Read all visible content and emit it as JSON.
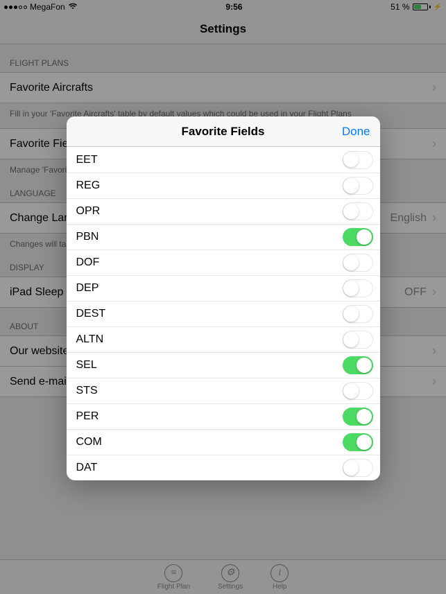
{
  "statusbar": {
    "carrier": "MegaFon",
    "time": "9:56",
    "battery_pct": "51 %"
  },
  "navbar": {
    "title": "Settings"
  },
  "sections": {
    "flight_plans": {
      "header": "FLIGHT PLANS",
      "favorite_aircrafts": "Favorite Aircrafts",
      "favorite_aircrafts_note": "Fill in your 'Favorite Aircrafts' table by default values which could be used in your Flight Plans",
      "favorite_fields": "Favorite Field",
      "favorite_fields_note": "Manage 'Favorit"
    },
    "language": {
      "header": "LANGUAGE",
      "change_language": "Change Lang",
      "change_language_value": "English",
      "change_note": "Changes will ta"
    },
    "display": {
      "header": "DISPLAY",
      "sleep": "iPad Sleep M",
      "sleep_value": "OFF"
    },
    "about": {
      "header": "ABOUT",
      "website": "Our website",
      "email": "Send e-mail"
    }
  },
  "tabbar": {
    "flight_plan": "Flight Plan",
    "settings": "Settings",
    "help": "Help"
  },
  "modal": {
    "title": "Favorite Fields",
    "done": "Done",
    "fields": [
      {
        "label": "EET",
        "on": false
      },
      {
        "label": "REG",
        "on": false
      },
      {
        "label": "OPR",
        "on": false
      },
      {
        "label": "PBN",
        "on": true
      },
      {
        "label": "DOF",
        "on": false
      },
      {
        "label": "DEP",
        "on": false
      },
      {
        "label": "DEST",
        "on": false
      },
      {
        "label": "ALTN",
        "on": false
      },
      {
        "label": "SEL",
        "on": true
      },
      {
        "label": "STS",
        "on": false
      },
      {
        "label": "PER",
        "on": true
      },
      {
        "label": "COM",
        "on": true
      },
      {
        "label": "DAT",
        "on": false
      }
    ]
  }
}
